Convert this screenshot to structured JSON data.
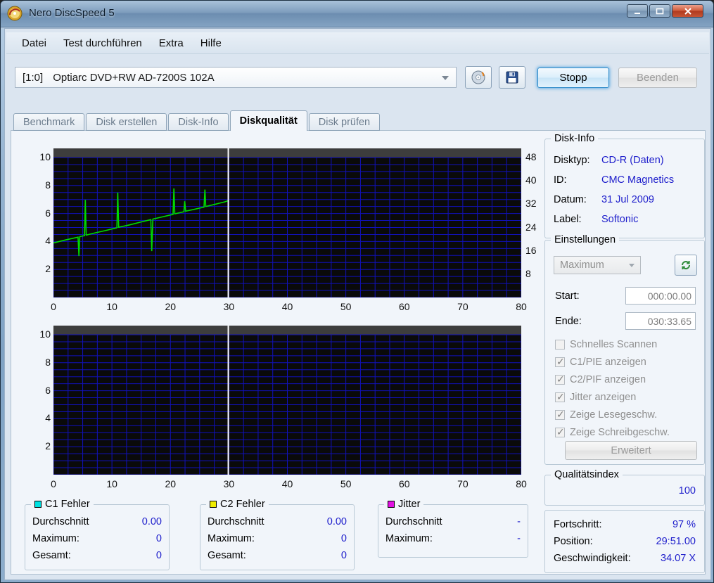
{
  "window": {
    "title": "Nero DiscSpeed 5"
  },
  "menu": {
    "items": [
      "Datei",
      "Test durchführen",
      "Extra",
      "Hilfe"
    ]
  },
  "toolbar": {
    "drive_id": "[1:0]",
    "drive_name": "Optiarc DVD+RW AD-7200S 102A",
    "stop_label": "Stopp",
    "quit_label": "Beenden"
  },
  "tabs": [
    {
      "label": "Benchmark",
      "active": false
    },
    {
      "label": "Disk erstellen",
      "active": false
    },
    {
      "label": "Disk-Info",
      "active": false
    },
    {
      "label": "Diskqualität",
      "active": true
    },
    {
      "label": "Disk prüfen",
      "active": false
    }
  ],
  "disk_info": {
    "title": "Disk-Info",
    "rows": [
      [
        "Disktyp:",
        "CD-R (Daten)"
      ],
      [
        "ID:",
        "CMC Magnetics"
      ],
      [
        "Datum:",
        "31 Jul 2009"
      ],
      [
        "Label:",
        "Softonic"
      ]
    ]
  },
  "settings": {
    "title": "Einstellungen",
    "speed_select": "Maximum",
    "start_label": "Start:",
    "start_value": "000:00.00",
    "end_label": "Ende:",
    "end_value": "030:33.65",
    "checkboxes": [
      {
        "label": "Schnelles Scannen",
        "checked": false
      },
      {
        "label": "C1/PIE anzeigen",
        "checked": true
      },
      {
        "label": "C2/PIF anzeigen",
        "checked": true
      },
      {
        "label": "Jitter anzeigen",
        "checked": true
      },
      {
        "label": "Zeige Lesegeschw.",
        "checked": true
      },
      {
        "label": "Zeige Schreibgeschw.",
        "checked": true
      }
    ],
    "advanced_label": "Erweitert"
  },
  "quality": {
    "title": "Qualitätsindex",
    "value": "100"
  },
  "progress": {
    "rows": [
      [
        "Fortschritt:",
        "97 %"
      ],
      [
        "Position:",
        "29:51.00"
      ],
      [
        "Geschwindigkeit:",
        "34.07 X"
      ]
    ]
  },
  "legend_groups": [
    {
      "title": "C1 Fehler",
      "color": "#00e1e1",
      "rows": [
        {
          "label": "Durchschnitt",
          "value": "0.00"
        },
        {
          "label": "Maximum:",
          "value": "0"
        },
        {
          "label": "Gesamt:",
          "value": "0"
        }
      ]
    },
    {
      "title": "C2 Fehler",
      "color": "#f0ed00",
      "rows": [
        {
          "label": "Durchschnitt",
          "value": "0.00"
        },
        {
          "label": "Maximum:",
          "value": "0"
        },
        {
          "label": "Gesamt:",
          "value": "0"
        }
      ]
    },
    {
      "title": "Jitter",
      "color": "#e211e2",
      "rows": [
        {
          "label": "Durchschnitt",
          "value": "-"
        },
        {
          "label": "Maximum:",
          "value": "-"
        }
      ]
    }
  ],
  "chart_data": [
    {
      "type": "line",
      "title": "disc-quality-scan-speed",
      "xlim": [
        0,
        80
      ],
      "x_ticks": [
        0,
        10,
        20,
        30,
        40,
        50,
        60,
        70,
        80
      ],
      "left_ylim": [
        0,
        10
      ],
      "left_ticks": [
        2,
        4,
        6,
        8,
        10
      ],
      "right_ylim": [
        0,
        48
      ],
      "right_ticks": [
        8,
        16,
        24,
        32,
        40,
        48
      ],
      "grid": true,
      "grid_color": "#1111bb",
      "cursor_x": 29.9,
      "series": [
        {
          "name": "read-speed",
          "axis": "right",
          "color": "#00dd00",
          "points": [
            [
              0,
              18.7
            ],
            [
              2,
              19.7
            ],
            [
              4.2,
              20.7
            ],
            [
              4.35,
              14.2
            ],
            [
              4.5,
              20.9
            ],
            [
              5.3,
              21.2
            ],
            [
              5.45,
              33.5
            ],
            [
              5.6,
              21.4
            ],
            [
              7,
              22.1
            ],
            [
              9,
              23.0
            ],
            [
              10.85,
              23.9
            ],
            [
              11.0,
              36.0
            ],
            [
              11.15,
              24.1
            ],
            [
              13,
              24.9
            ],
            [
              15,
              25.9
            ],
            [
              16.65,
              26.7
            ],
            [
              16.8,
              15.9
            ],
            [
              17.0,
              26.9
            ],
            [
              18.5,
              27.6
            ],
            [
              20.45,
              28.5
            ],
            [
              20.6,
              37.4
            ],
            [
              20.75,
              28.7
            ],
            [
              22.3,
              29.4
            ],
            [
              22.45,
              33.0
            ],
            [
              22.6,
              29.6
            ],
            [
              24,
              30.2
            ],
            [
              25.75,
              31.0
            ],
            [
              25.9,
              37.0
            ],
            [
              26.05,
              31.2
            ],
            [
              27.3,
              31.8
            ],
            [
              28.3,
              32.3
            ],
            [
              29.3,
              32.8
            ],
            [
              29.9,
              33.2
            ]
          ]
        }
      ]
    },
    {
      "type": "line",
      "title": "disc-quality-scan-errors",
      "xlim": [
        0,
        80
      ],
      "x_ticks": [
        0,
        10,
        20,
        30,
        40,
        50,
        60,
        70,
        80
      ],
      "left_ylim": [
        0,
        10
      ],
      "left_ticks": [
        2,
        4,
        6,
        8,
        10
      ],
      "grid": true,
      "grid_color": "#1111bb",
      "cursor_x": 29.9,
      "series": []
    }
  ]
}
